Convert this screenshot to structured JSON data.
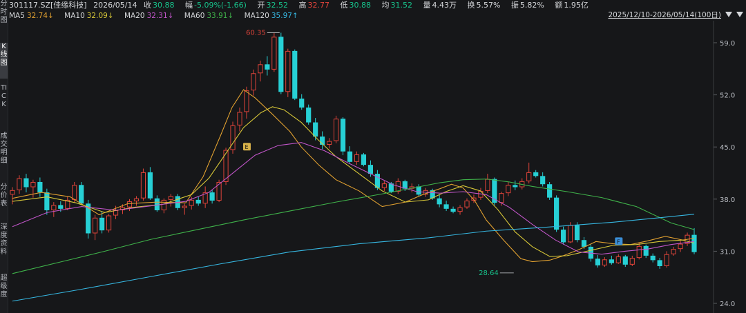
{
  "sidebar": {
    "buttons": [
      "分时图",
      "K线图",
      "TICK",
      "成交明细",
      "分价表",
      "深度资料",
      "超级度"
    ]
  },
  "quote": {
    "symbol": "301117.SZ[佳缘科技]",
    "date": "2026/05/14",
    "close_label": "收",
    "close": "30.88",
    "change_label": "幅",
    "change": "-5.09%(-1.66)",
    "open_label": "开",
    "open": "32.52",
    "high_label": "高",
    "high": "32.77",
    "low_label": "低",
    "low": "30.88",
    "avg_label": "均",
    "avg": "31.52",
    "vol_label": "量",
    "vol": "4.43万",
    "turn_label": "换",
    "turn": "5.57%",
    "amp_label": "振",
    "amp": "5.82%",
    "amt_label": "额",
    "amt": "1.95亿"
  },
  "ma": [
    {
      "label": "MA5",
      "value": "32.74↓",
      "color": "#e0a030"
    },
    {
      "label": "MA10",
      "value": "32.09↓",
      "color": "#d8c838"
    },
    {
      "label": "MA20",
      "value": "32.31↓",
      "color": "#c055c8"
    },
    {
      "label": "MA60",
      "value": "33.91↓",
      "color": "#3fb24a"
    },
    {
      "label": "MA120",
      "value": "35.97↑",
      "color": "#36b6e0"
    }
  ],
  "range_label": "2025/12/10-2026/05/14(100日)",
  "chart_data": {
    "type": "candlestick",
    "ylim": [
      24.0,
      62.0
    ],
    "yticks": [
      "59.0",
      "52.0",
      "45.0",
      "38.0",
      "31.0",
      "24.0"
    ],
    "annotations": [
      {
        "text": "60.35",
        "x_index": 39,
        "y": 60.35
      },
      {
        "text": "28.64",
        "x_index": 73,
        "y": 28.64
      },
      {
        "text": "E",
        "x_index": 34,
        "y": 45.0
      },
      {
        "text": "F",
        "x_index": 88,
        "y": 32.3
      }
    ],
    "ohlc": [
      [
        38.6,
        39.6,
        37.3,
        39.2
      ],
      [
        39.2,
        41.2,
        38.7,
        40.8
      ],
      [
        40.8,
        41.4,
        38.9,
        39.6
      ],
      [
        39.6,
        40.6,
        38.2,
        40.3
      ],
      [
        40.3,
        40.9,
        38.3,
        38.9
      ],
      [
        38.9,
        39.4,
        35.9,
        36.5
      ],
      [
        36.5,
        37.6,
        35.6,
        37.2
      ],
      [
        37.2,
        37.7,
        36.3,
        36.7
      ],
      [
        36.7,
        38.3,
        36.5,
        37.9
      ],
      [
        37.9,
        40.3,
        37.6,
        39.9
      ],
      [
        39.9,
        40.3,
        37.2,
        37.4
      ],
      [
        37.4,
        37.9,
        32.7,
        33.4
      ],
      [
        33.4,
        35.9,
        32.5,
        35.5
      ],
      [
        35.5,
        36.3,
        33.4,
        33.8
      ],
      [
        33.8,
        36.0,
        33.5,
        35.8
      ],
      [
        35.8,
        37.1,
        35.3,
        36.5
      ],
      [
        36.5,
        37.3,
        36.0,
        36.9
      ],
      [
        36.9,
        38.0,
        36.4,
        37.7
      ],
      [
        37.7,
        38.4,
        37.1,
        38.1
      ],
      [
        38.1,
        42.1,
        37.8,
        41.6
      ],
      [
        41.6,
        42.3,
        37.9,
        38.1
      ],
      [
        38.1,
        38.5,
        36.3,
        36.5
      ],
      [
        36.5,
        38.1,
        36.1,
        37.9
      ],
      [
        37.9,
        38.7,
        37.0,
        38.4
      ],
      [
        38.4,
        38.7,
        36.5,
        36.8
      ],
      [
        36.8,
        37.4,
        35.9,
        37.1
      ],
      [
        37.1,
        38.3,
        36.6,
        37.9
      ],
      [
        37.9,
        38.3,
        37.1,
        37.4
      ],
      [
        37.4,
        39.7,
        36.8,
        38.9
      ],
      [
        38.9,
        39.2,
        37.4,
        37.8
      ],
      [
        37.8,
        40.6,
        37.6,
        40.3
      ],
      [
        40.3,
        44.9,
        39.9,
        44.6
      ],
      [
        44.6,
        48.4,
        44.1,
        47.9
      ],
      [
        47.9,
        50.3,
        47.1,
        49.7
      ],
      [
        49.7,
        53.1,
        48.8,
        52.6
      ],
      [
        52.6,
        55.4,
        51.9,
        54.9
      ],
      [
        54.9,
        56.6,
        53.8,
        56.1
      ],
      [
        56.1,
        57.2,
        54.6,
        55.4
      ],
      [
        55.4,
        60.3,
        55.1,
        59.8
      ],
      [
        59.8,
        60.35,
        52.1,
        52.4
      ],
      [
        52.4,
        58.2,
        51.7,
        57.9
      ],
      [
        57.9,
        58.1,
        51.3,
        51.5
      ],
      [
        51.5,
        52.1,
        50.0,
        50.3
      ],
      [
        50.3,
        50.7,
        48.0,
        48.3
      ],
      [
        48.3,
        48.9,
        45.9,
        46.4
      ],
      [
        46.4,
        47.1,
        44.7,
        45.3
      ],
      [
        45.3,
        46.2,
        44.8,
        45.8
      ],
      [
        45.8,
        49.2,
        45.5,
        48.8
      ],
      [
        48.8,
        49.0,
        43.9,
        44.4
      ],
      [
        44.4,
        45.1,
        42.8,
        43.0
      ],
      [
        43.0,
        44.4,
        42.6,
        44.0
      ],
      [
        44.0,
        44.2,
        42.4,
        42.6
      ],
      [
        42.6,
        43.2,
        41.0,
        41.4
      ],
      [
        41.4,
        41.9,
        39.2,
        39.5
      ],
      [
        39.5,
        40.4,
        39.1,
        40.1
      ],
      [
        40.1,
        40.3,
        38.8,
        39.0
      ],
      [
        39.0,
        40.8,
        38.7,
        40.4
      ],
      [
        40.4,
        40.6,
        39.1,
        39.4
      ],
      [
        39.4,
        40.1,
        38.9,
        39.7
      ],
      [
        39.7,
        40.0,
        38.4,
        38.6
      ],
      [
        38.6,
        39.5,
        38.3,
        39.2
      ],
      [
        39.2,
        39.4,
        37.9,
        38.1
      ],
      [
        38.1,
        38.6,
        36.9,
        37.3
      ],
      [
        37.3,
        37.8,
        36.4,
        36.7
      ],
      [
        36.7,
        37.0,
        36.1,
        36.3
      ],
      [
        36.3,
        37.2,
        35.9,
        36.9
      ],
      [
        36.9,
        38.1,
        36.7,
        37.8
      ],
      [
        37.8,
        38.6,
        37.5,
        38.2
      ],
      [
        38.2,
        39.5,
        37.9,
        39.1
      ],
      [
        39.1,
        41.4,
        38.8,
        40.7
      ],
      [
        40.7,
        40.9,
        37.2,
        37.5
      ],
      [
        37.5,
        39.0,
        37.1,
        38.8
      ],
      [
        38.8,
        40.3,
        38.4,
        39.9
      ],
      [
        39.9,
        40.5,
        39.2,
        39.6
      ],
      [
        39.6,
        40.8,
        39.3,
        40.4
      ],
      [
        40.4,
        42.9,
        40.1,
        41.6
      ],
      [
        41.6,
        41.9,
        40.9,
        41.1
      ],
      [
        41.1,
        41.6,
        39.7,
        40.0
      ],
      [
        40.0,
        40.3,
        37.9,
        38.2
      ],
      [
        38.2,
        38.5,
        33.6,
        33.9
      ],
      [
        33.9,
        34.3,
        31.9,
        32.2
      ],
      [
        32.2,
        34.9,
        32.1,
        34.5
      ],
      [
        34.5,
        34.9,
        32.2,
        32.5
      ],
      [
        32.5,
        32.9,
        31.3,
        31.6
      ],
      [
        31.6,
        31.9,
        29.6,
        30.0
      ],
      [
        30.0,
        30.5,
        28.8,
        29.1
      ],
      [
        29.1,
        30.2,
        28.9,
        29.9
      ],
      [
        29.9,
        30.4,
        29.2,
        29.4
      ],
      [
        29.4,
        30.6,
        29.3,
        30.3
      ],
      [
        30.3,
        30.5,
        28.9,
        29.2
      ],
      [
        29.2,
        30.4,
        29.0,
        30.1
      ],
      [
        30.1,
        32.1,
        29.9,
        31.7
      ],
      [
        31.7,
        31.9,
        30.1,
        30.4
      ],
      [
        30.4,
        30.7,
        29.5,
        29.8
      ],
      [
        29.8,
        30.1,
        28.64,
        29.0
      ],
      [
        29.0,
        31.0,
        28.8,
        30.6
      ],
      [
        30.6,
        31.6,
        30.4,
        31.3
      ],
      [
        31.3,
        32.4,
        30.9,
        32.0
      ],
      [
        32.0,
        33.5,
        31.7,
        33.2
      ],
      [
        33.2,
        34.1,
        30.6,
        30.88
      ]
    ],
    "ma_series": [
      {
        "name": "MA5",
        "color": "#e0a030",
        "values": [
          [
            0,
            38.1
          ],
          [
            5,
            38.9
          ],
          [
            10,
            38.3
          ],
          [
            15,
            35.9
          ],
          [
            20,
            37.4
          ],
          [
            25,
            37.6
          ],
          [
            30,
            37.5
          ],
          [
            33,
            41.0
          ],
          [
            36,
            46.5
          ],
          [
            38,
            50.3
          ],
          [
            40,
            52.7
          ],
          [
            42,
            51.6
          ],
          [
            45,
            49.4
          ],
          [
            48,
            47.1
          ],
          [
            50,
            45.0
          ],
          [
            53,
            42.6
          ],
          [
            56,
            40.6
          ],
          [
            60,
            39.1
          ],
          [
            64,
            37.0
          ],
          [
            68,
            37.6
          ],
          [
            71,
            38.6
          ],
          [
            74,
            39.4
          ],
          [
            76,
            40.0
          ],
          [
            78,
            39.5
          ],
          [
            80,
            37.8
          ],
          [
            82,
            35.2
          ],
          [
            85,
            32.5
          ],
          [
            88,
            30.0
          ],
          [
            90,
            29.6
          ],
          [
            93,
            29.8
          ],
          [
            95,
            30.3
          ],
          [
            98,
            31.2
          ],
          [
            101,
            32.3
          ],
          [
            104,
            32.0
          ],
          [
            107,
            31.9
          ],
          [
            110,
            32.4
          ],
          [
            113,
            33.0
          ],
          [
            116,
            32.5
          ],
          [
            118,
            32.74
          ]
        ]
      },
      {
        "name": "MA10",
        "color": "#d8c838",
        "values": [
          [
            0,
            37.7
          ],
          [
            6,
            38.3
          ],
          [
            11,
            37.5
          ],
          [
            16,
            36.2
          ],
          [
            21,
            36.9
          ],
          [
            26,
            37.3
          ],
          [
            31,
            38.6
          ],
          [
            34,
            40.8
          ],
          [
            37,
            44.2
          ],
          [
            40,
            47.6
          ],
          [
            43,
            49.6
          ],
          [
            45,
            50.4
          ],
          [
            47,
            50.0
          ],
          [
            50,
            48.3
          ],
          [
            53,
            45.9
          ],
          [
            56,
            43.7
          ],
          [
            60,
            41.4
          ],
          [
            64,
            39.1
          ],
          [
            68,
            37.6
          ],
          [
            72,
            37.9
          ],
          [
            75,
            39.0
          ],
          [
            78,
            39.8
          ],
          [
            81,
            39.1
          ],
          [
            84,
            36.6
          ],
          [
            87,
            33.6
          ],
          [
            90,
            31.6
          ],
          [
            93,
            30.3
          ],
          [
            96,
            30.4
          ],
          [
            100,
            31.1
          ],
          [
            104,
            31.8
          ],
          [
            108,
            31.9
          ],
          [
            112,
            32.3
          ],
          [
            116,
            32.5
          ],
          [
            118,
            32.09
          ]
        ]
      },
      {
        "name": "MA20",
        "color": "#c055c8",
        "values": [
          [
            0,
            34.3
          ],
          [
            6,
            36.2
          ],
          [
            12,
            37.0
          ],
          [
            18,
            36.5
          ],
          [
            24,
            37.1
          ],
          [
            30,
            37.7
          ],
          [
            34,
            38.9
          ],
          [
            38,
            41.4
          ],
          [
            42,
            43.9
          ],
          [
            46,
            45.2
          ],
          [
            50,
            45.6
          ],
          [
            54,
            44.5
          ],
          [
            58,
            42.9
          ],
          [
            62,
            41.4
          ],
          [
            66,
            39.9
          ],
          [
            70,
            39.0
          ],
          [
            74,
            38.8
          ],
          [
            78,
            39.0
          ],
          [
            82,
            38.6
          ],
          [
            86,
            36.9
          ],
          [
            90,
            34.6
          ],
          [
            94,
            32.5
          ],
          [
            98,
            30.9
          ],
          [
            102,
            30.6
          ],
          [
            106,
            31.0
          ],
          [
            110,
            31.3
          ],
          [
            114,
            31.9
          ],
          [
            118,
            32.31
          ]
        ]
      },
      {
        "name": "MA60",
        "color": "#3fb24a",
        "values": [
          [
            0,
            28.0
          ],
          [
            8,
            29.5
          ],
          [
            16,
            31.0
          ],
          [
            24,
            32.6
          ],
          [
            32,
            33.9
          ],
          [
            40,
            35.2
          ],
          [
            48,
            36.4
          ],
          [
            56,
            37.6
          ],
          [
            64,
            38.7
          ],
          [
            70,
            39.6
          ],
          [
            74,
            40.2
          ],
          [
            78,
            40.6
          ],
          [
            82,
            40.7
          ],
          [
            86,
            40.3
          ],
          [
            90,
            39.7
          ],
          [
            96,
            39.0
          ],
          [
            102,
            38.2
          ],
          [
            108,
            37.0
          ],
          [
            114,
            34.8
          ],
          [
            118,
            33.91
          ]
        ]
      },
      {
        "name": "MA120",
        "color": "#36b6e0",
        "values": [
          [
            0,
            24.3
          ],
          [
            12,
            25.9
          ],
          [
            24,
            27.6
          ],
          [
            36,
            29.3
          ],
          [
            48,
            30.9
          ],
          [
            60,
            32.0
          ],
          [
            72,
            32.8
          ],
          [
            82,
            33.7
          ],
          [
            92,
            34.2
          ],
          [
            104,
            34.9
          ],
          [
            112,
            35.5
          ],
          [
            118,
            35.97
          ]
        ]
      }
    ]
  }
}
